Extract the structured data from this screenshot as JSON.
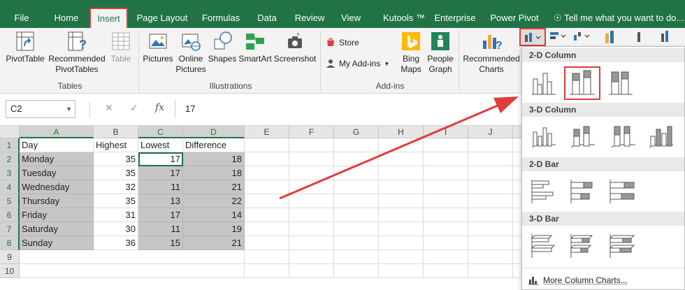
{
  "tabs": [
    {
      "label": "File"
    },
    {
      "label": "Home"
    },
    {
      "label": "Insert"
    },
    {
      "label": "Page Layout"
    },
    {
      "label": "Formulas"
    },
    {
      "label": "Data"
    },
    {
      "label": "Review"
    },
    {
      "label": "View"
    },
    {
      "label": "Kutools ™"
    },
    {
      "label": "Enterprise"
    },
    {
      "label": "Power Pivot"
    }
  ],
  "tell_me": "Tell me what you want to do...",
  "ribbon": {
    "tables": {
      "pivottable": "PivotTable",
      "recommended_line1": "Recommended",
      "recommended_line2": "PivotTables",
      "table": "Table",
      "group": "Tables"
    },
    "illustrations": {
      "pictures": "Pictures",
      "online_line1": "Online",
      "online_line2": "Pictures",
      "shapes": "Shapes",
      "smartart": "SmartArt",
      "screenshot": "Screenshot",
      "group": "Illustrations"
    },
    "addins": {
      "store": "Store",
      "my_addins": "My Add-ins",
      "bing_line1": "Bing",
      "bing_line2": "Maps",
      "people_line1": "People",
      "people_line2": "Graph",
      "group": "Add-ins"
    },
    "charts": {
      "rec_line1": "Recommended",
      "rec_line2": "Charts"
    }
  },
  "formula_bar": {
    "name_box": "C2",
    "fx": "fx",
    "value": "17"
  },
  "columns": [
    "A",
    "B",
    "C",
    "D",
    "E",
    "F",
    "G",
    "H",
    "I",
    "J"
  ],
  "rows": [
    "1",
    "2",
    "3",
    "4",
    "5",
    "6",
    "7",
    "8",
    "9",
    "10"
  ],
  "sheet": {
    "headers": [
      "Day",
      "Highest",
      "Lowest",
      "Difference"
    ],
    "data": [
      [
        "Monday",
        "35",
        "17",
        "18"
      ],
      [
        "Tuesday",
        "35",
        "17",
        "18"
      ],
      [
        "Wednesday",
        "32",
        "11",
        "21"
      ],
      [
        "Thursday",
        "35",
        "13",
        "22"
      ],
      [
        "Friday",
        "31",
        "17",
        "14"
      ],
      [
        "Saturday",
        "30",
        "11",
        "19"
      ],
      [
        "Sunday",
        "36",
        "15",
        "21"
      ]
    ]
  },
  "dropdown": {
    "sections": [
      "2-D Column",
      "3-D Column",
      "2-D Bar",
      "3-D Bar"
    ],
    "more": "More Column Charts..."
  },
  "colors": {
    "excel_green": "#217346",
    "highlight_red": "#e23b3b"
  }
}
